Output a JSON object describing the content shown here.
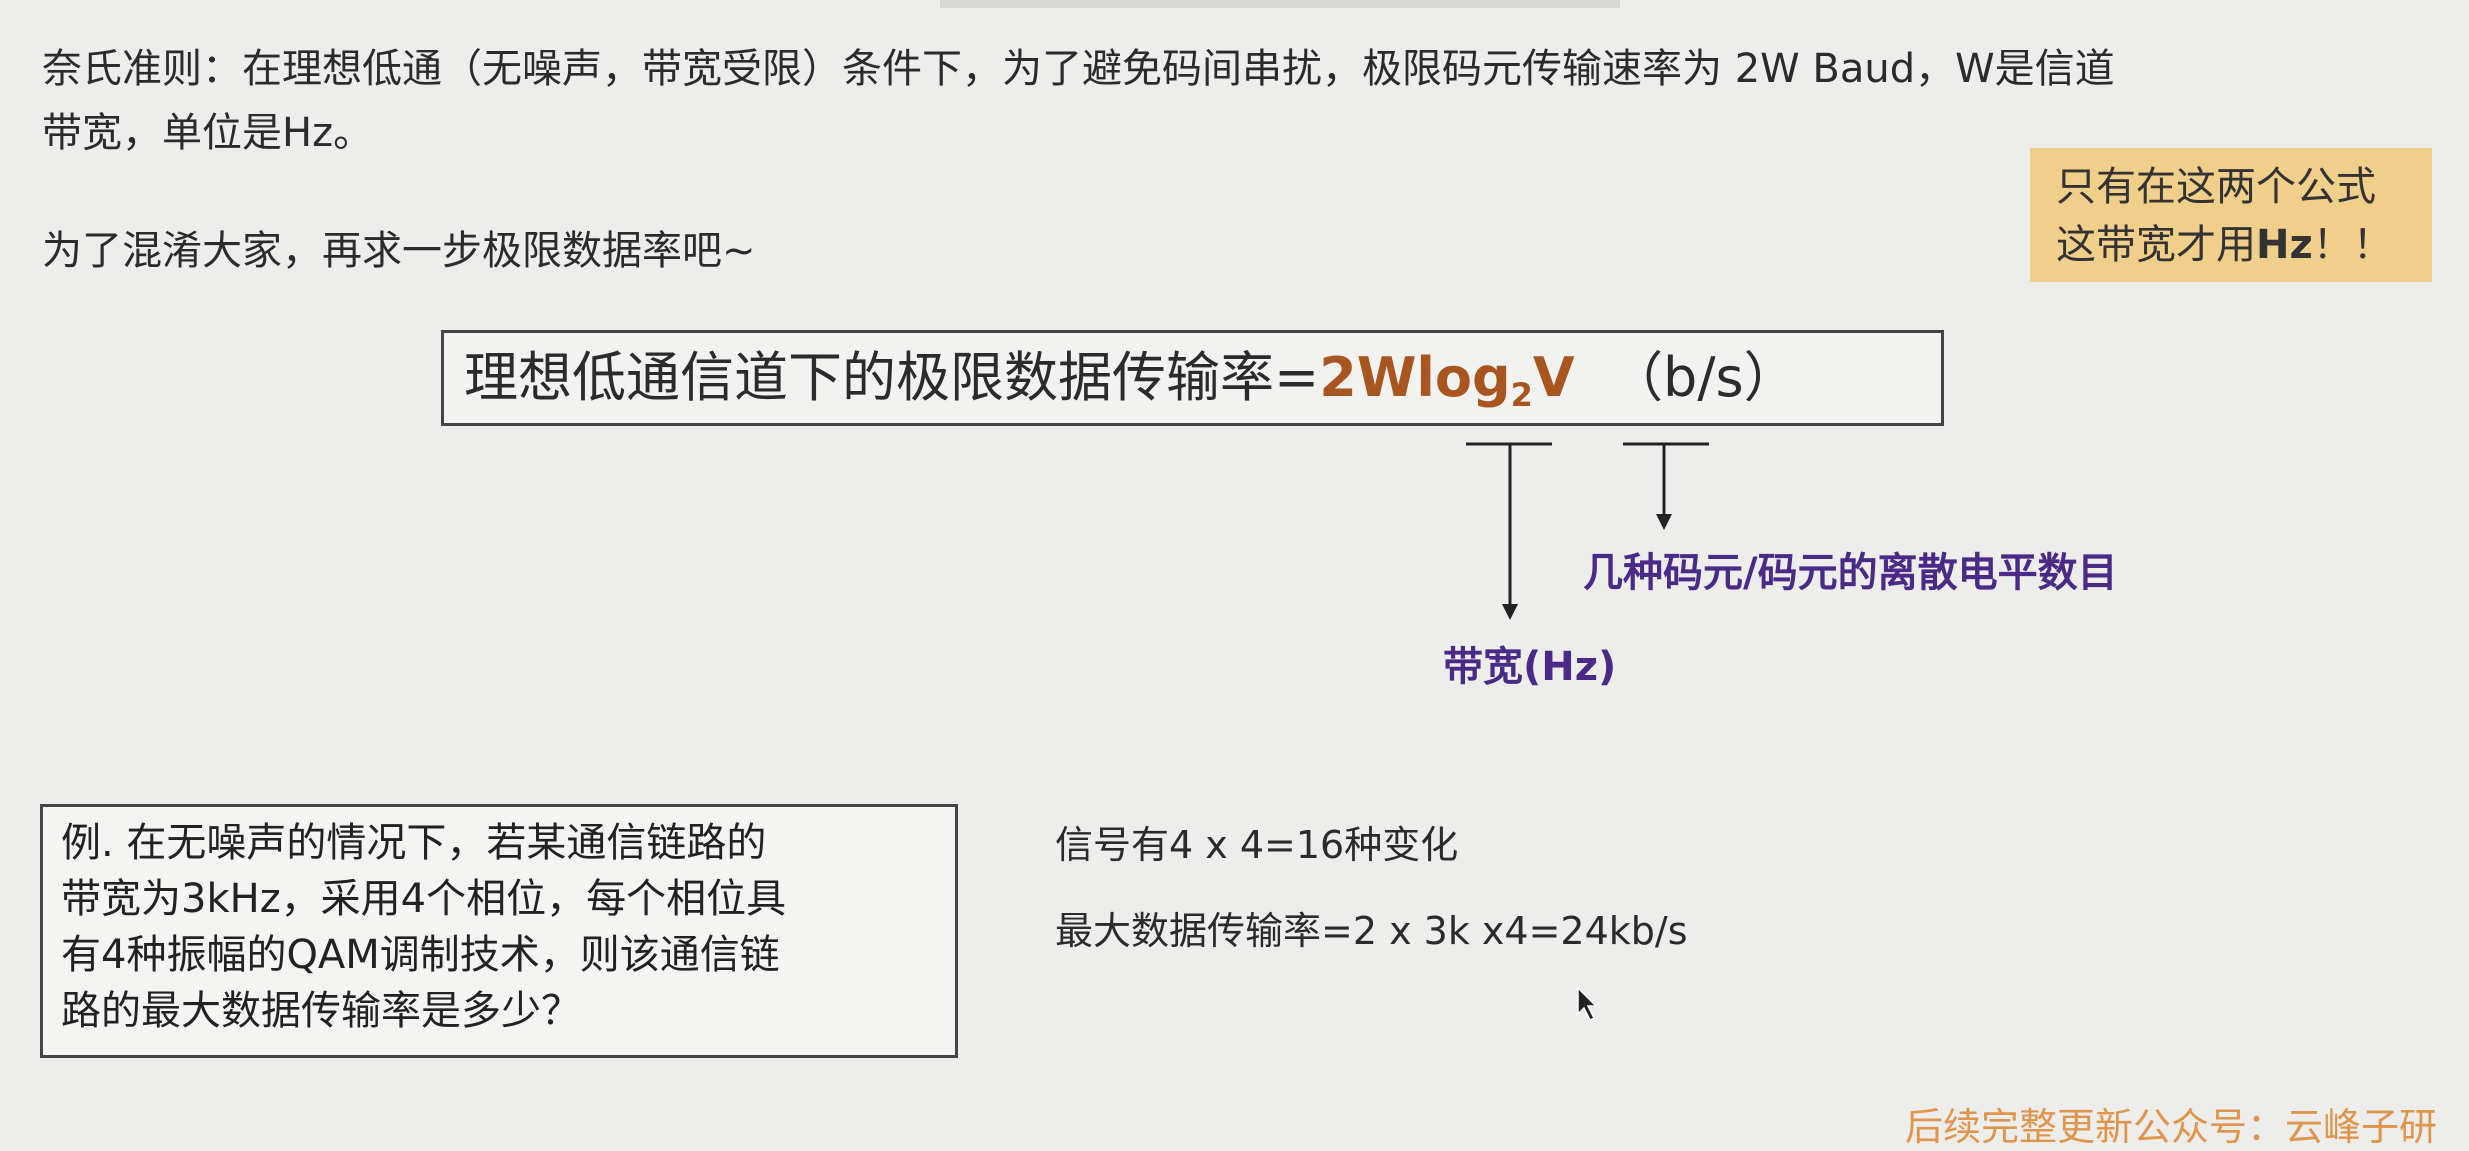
{
  "text": {
    "line1": "奈氏准则：在理想低通（无噪声，带宽受限）条件下，为了避免码间串扰，极限码元传输速率为 2W Baud，W是信道",
    "line2": "带宽，单位是Hz。",
    "line3": "为了混淆大家，再求一步极限数据率吧~"
  },
  "note": {
    "line1": "只有在这两个公式",
    "line2_prefix": "这带宽才用",
    "line2_bold": "Hz",
    "line2_suffix": "！！"
  },
  "formula": {
    "prefix": "理想低通信道下的极限数据传输率=",
    "hl_main": "2Wlog",
    "hl_sub": "2",
    "hl_var": "V",
    "unit": "（b/s）"
  },
  "annotations": {
    "levels": "几种码元/码元的离散电平数目",
    "bandwidth": "带宽(Hz)"
  },
  "example": {
    "lines": [
      "例. 在无噪声的情况下，若某通信链路的",
      "带宽为3kHz，采用4个相位，每个相位具",
      "有4种振幅的QAM调制技术，则该通信链",
      "路的最大数据传输率是多少？"
    ]
  },
  "answer": {
    "line1": "信号有4 x 4=16种变化",
    "line2": "最大数据传输率=2 x 3k x4=24kb/s"
  },
  "footer": "后续完整更新公众号：云峰子研",
  "colors": {
    "background": "#ededec",
    "formula_highlight": "#a8551f",
    "annotation": "#4a2a86",
    "note_bg": "#f0cf8a",
    "footer": "#e0954d"
  }
}
